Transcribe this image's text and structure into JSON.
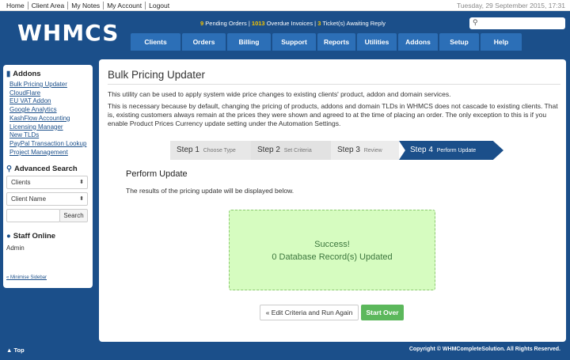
{
  "topbar": {
    "links": [
      "Home",
      "Client Area",
      "My Notes",
      "My Account",
      "Logout"
    ],
    "date": "Tuesday, 29 September 2015, 17:31"
  },
  "header": {
    "logo": "WHMCS",
    "alerts": {
      "pending_orders_count": "9",
      "pending_orders_label": "Pending Orders",
      "overdue_count": "1013",
      "overdue_label": "Overdue Invoices",
      "tickets_count": "3",
      "tickets_label": "Ticket(s) Awaiting Reply"
    },
    "nav": [
      "Clients",
      "Orders",
      "Billing",
      "Support",
      "Reports",
      "Utilities",
      "Addons",
      "Setup",
      "Help"
    ]
  },
  "sidebar": {
    "addons_title": "Addons",
    "addon_links": [
      "Bulk Pricing Updater",
      "CloudFlare",
      "EU VAT Addon",
      "Google Analytics",
      "KashFlow Accounting",
      "Licensing Manager",
      "New TLDs",
      "PayPal Transaction Lookup",
      "Project Management"
    ],
    "search_title": "Advanced Search",
    "search_type": "Clients",
    "search_field": "Client Name",
    "search_button": "Search",
    "staff_title": "Staff Online",
    "staff_name": "Admin",
    "minimise": "« Minimise Sidebar"
  },
  "main": {
    "title": "Bulk Pricing Updater",
    "para1": "This utility can be used to apply system wide price changes to existing clients' product, addon and domain services.",
    "para2": "This is necessary because by default, changing the pricing of products, addons and domain TLDs in WHMCS does not cascade to existing clients. That is, existing customers always remain at the prices they were shown and agreed to at the time of placing an order. The only exception to this is if you enable Product Prices Currency update setting under the Automation Settings.",
    "steps": [
      {
        "label": "Step 1",
        "sub": "Choose Type"
      },
      {
        "label": "Step 2",
        "sub": "Set Criteria"
      },
      {
        "label": "Step 3",
        "sub": "Review"
      },
      {
        "label": "Step 4",
        "sub": "Perform Update"
      }
    ],
    "section_title": "Perform Update",
    "section_text": "The results of the pricing update will be displayed below.",
    "success_line1": "Success!",
    "success_line2": "0 Database Record(s) Updated",
    "edit_button": "« Edit Criteria and Run Again",
    "start_button": "Start Over"
  },
  "footer": {
    "top": "▲ Top",
    "copyright": "Copyright © WHMCompleteSolution. All Rights Reserved."
  }
}
